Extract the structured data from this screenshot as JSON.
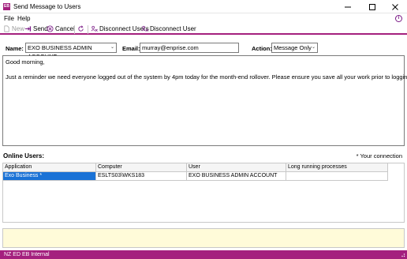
{
  "window": {
    "icon_text": "EB",
    "title": "Send Message to Users"
  },
  "menu": {
    "file": "File",
    "help": "Help"
  },
  "toolbar": {
    "new_label": "New",
    "send_label": "Send",
    "cancel_label": "Cancel",
    "disconnect_users_label": "Disconnect Users",
    "disconnect_user_label": "Disconnect User"
  },
  "form": {
    "name_label": "Name:",
    "name_value": "EXO BUSINESS ADMIN ACCOUNT",
    "email_label": "Email:",
    "email_value": "murray@enprise.com",
    "action_label": "Action:",
    "action_value": "Message Only"
  },
  "message": {
    "line1": "Good morning,",
    "line2": "Just a reminder we need everyone logged out of the system by 4pm today for the month-end rollover.  Please ensure you save all your work prior to logging out."
  },
  "online_users": {
    "section_label": "Online Users:",
    "your_connection_note": "* Your connection",
    "columns": [
      "Application",
      "Computer",
      "User",
      "Long running processes"
    ],
    "rows": [
      {
        "application": "Exo Business *",
        "computer": "ESLTS03\\WKS183",
        "user": "EXO BUSINESS ADMIN ACCOUNT",
        "long_running": ""
      }
    ]
  },
  "status": {
    "text": "NZ ED EB Internal"
  },
  "colors": {
    "brand": "#a4207e",
    "selection": "#1a72d6",
    "note_background": "#fffbd9"
  }
}
